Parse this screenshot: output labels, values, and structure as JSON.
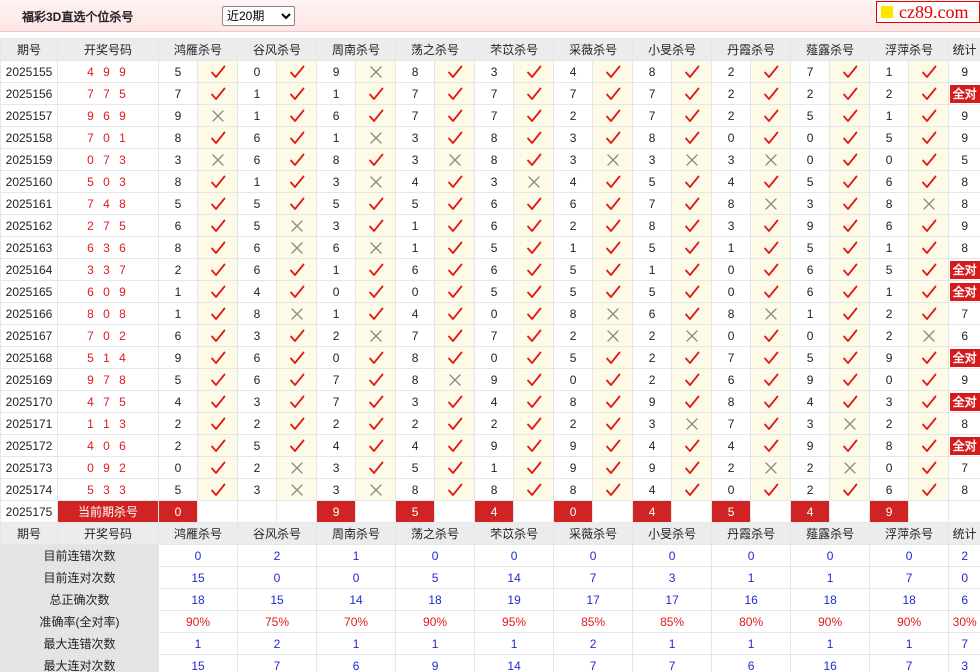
{
  "header": {
    "title": "福彩3D直选个位杀号",
    "period_select": "近20期",
    "logo": "cz89.com"
  },
  "columns": [
    "期号",
    "开奖号码",
    "鸿雁杀号",
    "谷风杀号",
    "周南杀号",
    "荡之杀号",
    "芣苡杀号",
    "采薇杀号",
    "小旻杀号",
    "丹霞杀号",
    "薤露杀号",
    "浮萍杀号",
    "统计"
  ],
  "rows": [
    {
      "period": "2025155",
      "win": "4 9 9",
      "kills": [
        [
          "5",
          "y"
        ],
        [
          "0",
          "y"
        ],
        [
          "9",
          "n"
        ],
        [
          "8",
          "y"
        ],
        [
          "3",
          "y"
        ],
        [
          "4",
          "y"
        ],
        [
          "8",
          "y"
        ],
        [
          "2",
          "y"
        ],
        [
          "7",
          "y"
        ],
        [
          "1",
          "y"
        ]
      ],
      "stat": "9"
    },
    {
      "period": "2025156",
      "win": "7 7 5",
      "kills": [
        [
          "7",
          "y"
        ],
        [
          "1",
          "y"
        ],
        [
          "1",
          "y"
        ],
        [
          "7",
          "y"
        ],
        [
          "7",
          "y"
        ],
        [
          "7",
          "y"
        ],
        [
          "7",
          "y"
        ],
        [
          "2",
          "y"
        ],
        [
          "2",
          "y"
        ],
        [
          "2",
          "y"
        ]
      ],
      "stat": "全对"
    },
    {
      "period": "2025157",
      "win": "9 6 9",
      "kills": [
        [
          "9",
          "n"
        ],
        [
          "1",
          "y"
        ],
        [
          "6",
          "y"
        ],
        [
          "7",
          "y"
        ],
        [
          "7",
          "y"
        ],
        [
          "2",
          "y"
        ],
        [
          "7",
          "y"
        ],
        [
          "2",
          "y"
        ],
        [
          "5",
          "y"
        ],
        [
          "1",
          "y"
        ]
      ],
      "stat": "9"
    },
    {
      "period": "2025158",
      "win": "7 0 1",
      "kills": [
        [
          "8",
          "y"
        ],
        [
          "6",
          "y"
        ],
        [
          "1",
          "n"
        ],
        [
          "3",
          "y"
        ],
        [
          "8",
          "y"
        ],
        [
          "3",
          "y"
        ],
        [
          "8",
          "y"
        ],
        [
          "0",
          "y"
        ],
        [
          "0",
          "y"
        ],
        [
          "5",
          "y"
        ]
      ],
      "stat": "9"
    },
    {
      "period": "2025159",
      "win": "0 7 3",
      "kills": [
        [
          "3",
          "n"
        ],
        [
          "6",
          "y"
        ],
        [
          "8",
          "y"
        ],
        [
          "3",
          "n"
        ],
        [
          "8",
          "y"
        ],
        [
          "3",
          "n"
        ],
        [
          "3",
          "n"
        ],
        [
          "3",
          "n"
        ],
        [
          "0",
          "y"
        ],
        [
          "0",
          "y"
        ]
      ],
      "stat": "5"
    },
    {
      "period": "2025160",
      "win": "5 0 3",
      "kills": [
        [
          "8",
          "y"
        ],
        [
          "1",
          "y"
        ],
        [
          "3",
          "n"
        ],
        [
          "4",
          "y"
        ],
        [
          "3",
          "n"
        ],
        [
          "4",
          "y"
        ],
        [
          "5",
          "y"
        ],
        [
          "4",
          "y"
        ],
        [
          "5",
          "y"
        ],
        [
          "6",
          "y"
        ]
      ],
      "stat": "8"
    },
    {
      "period": "2025161",
      "win": "7 4 8",
      "kills": [
        [
          "5",
          "y"
        ],
        [
          "5",
          "y"
        ],
        [
          "5",
          "y"
        ],
        [
          "5",
          "y"
        ],
        [
          "6",
          "y"
        ],
        [
          "6",
          "y"
        ],
        [
          "7",
          "y"
        ],
        [
          "8",
          "n"
        ],
        [
          "3",
          "y"
        ],
        [
          "8",
          "n"
        ]
      ],
      "stat": "8"
    },
    {
      "period": "2025162",
      "win": "2 7 5",
      "kills": [
        [
          "6",
          "y"
        ],
        [
          "5",
          "n"
        ],
        [
          "3",
          "y"
        ],
        [
          "1",
          "y"
        ],
        [
          "6",
          "y"
        ],
        [
          "2",
          "y"
        ],
        [
          "8",
          "y"
        ],
        [
          "3",
          "y"
        ],
        [
          "9",
          "y"
        ],
        [
          "6",
          "y"
        ]
      ],
      "stat": "9"
    },
    {
      "period": "2025163",
      "win": "6 3 6",
      "kills": [
        [
          "8",
          "y"
        ],
        [
          "6",
          "n"
        ],
        [
          "6",
          "n"
        ],
        [
          "1",
          "y"
        ],
        [
          "5",
          "y"
        ],
        [
          "1",
          "y"
        ],
        [
          "5",
          "y"
        ],
        [
          "1",
          "y"
        ],
        [
          "5",
          "y"
        ],
        [
          "1",
          "y"
        ]
      ],
      "stat": "8"
    },
    {
      "period": "2025164",
      "win": "3 3 7",
      "kills": [
        [
          "2",
          "y"
        ],
        [
          "6",
          "y"
        ],
        [
          "1",
          "y"
        ],
        [
          "6",
          "y"
        ],
        [
          "6",
          "y"
        ],
        [
          "5",
          "y"
        ],
        [
          "1",
          "y"
        ],
        [
          "0",
          "y"
        ],
        [
          "6",
          "y"
        ],
        [
          "5",
          "y"
        ]
      ],
      "stat": "全对"
    },
    {
      "period": "2025165",
      "win": "6 0 9",
      "kills": [
        [
          "1",
          "y"
        ],
        [
          "4",
          "y"
        ],
        [
          "0",
          "y"
        ],
        [
          "0",
          "y"
        ],
        [
          "5",
          "y"
        ],
        [
          "5",
          "y"
        ],
        [
          "5",
          "y"
        ],
        [
          "0",
          "y"
        ],
        [
          "6",
          "y"
        ],
        [
          "1",
          "y"
        ]
      ],
      "stat": "全对"
    },
    {
      "period": "2025166",
      "win": "8 0 8",
      "kills": [
        [
          "1",
          "y"
        ],
        [
          "8",
          "n"
        ],
        [
          "1",
          "y"
        ],
        [
          "4",
          "y"
        ],
        [
          "0",
          "y"
        ],
        [
          "8",
          "n"
        ],
        [
          "6",
          "y"
        ],
        [
          "8",
          "n"
        ],
        [
          "1",
          "y"
        ],
        [
          "2",
          "y"
        ]
      ],
      "stat": "7"
    },
    {
      "period": "2025167",
      "win": "7 0 2",
      "kills": [
        [
          "6",
          "y"
        ],
        [
          "3",
          "y"
        ],
        [
          "2",
          "n"
        ],
        [
          "7",
          "y"
        ],
        [
          "7",
          "y"
        ],
        [
          "2",
          "n"
        ],
        [
          "2",
          "n"
        ],
        [
          "0",
          "y"
        ],
        [
          "0",
          "y"
        ],
        [
          "2",
          "n"
        ]
      ],
      "stat": "6"
    },
    {
      "period": "2025168",
      "win": "5 1 4",
      "kills": [
        [
          "9",
          "y"
        ],
        [
          "6",
          "y"
        ],
        [
          "0",
          "y"
        ],
        [
          "8",
          "y"
        ],
        [
          "0",
          "y"
        ],
        [
          "5",
          "y"
        ],
        [
          "2",
          "y"
        ],
        [
          "7",
          "y"
        ],
        [
          "5",
          "y"
        ],
        [
          "9",
          "y"
        ]
      ],
      "stat": "全对"
    },
    {
      "period": "2025169",
      "win": "9 7 8",
      "kills": [
        [
          "5",
          "y"
        ],
        [
          "6",
          "y"
        ],
        [
          "7",
          "y"
        ],
        [
          "8",
          "n"
        ],
        [
          "9",
          "y"
        ],
        [
          "0",
          "y"
        ],
        [
          "2",
          "y"
        ],
        [
          "6",
          "y"
        ],
        [
          "9",
          "y"
        ],
        [
          "0",
          "y"
        ]
      ],
      "stat": "9"
    },
    {
      "period": "2025170",
      "win": "4 7 5",
      "kills": [
        [
          "4",
          "y"
        ],
        [
          "3",
          "y"
        ],
        [
          "7",
          "y"
        ],
        [
          "3",
          "y"
        ],
        [
          "4",
          "y"
        ],
        [
          "8",
          "y"
        ],
        [
          "9",
          "y"
        ],
        [
          "8",
          "y"
        ],
        [
          "4",
          "y"
        ],
        [
          "3",
          "y"
        ]
      ],
      "stat": "全对"
    },
    {
      "period": "2025171",
      "win": "1 1 3",
      "kills": [
        [
          "2",
          "y"
        ],
        [
          "2",
          "y"
        ],
        [
          "2",
          "y"
        ],
        [
          "2",
          "y"
        ],
        [
          "2",
          "y"
        ],
        [
          "2",
          "y"
        ],
        [
          "3",
          "n"
        ],
        [
          "7",
          "y"
        ],
        [
          "3",
          "n"
        ],
        [
          "2",
          "y"
        ]
      ],
      "stat": "8"
    },
    {
      "period": "2025172",
      "win": "4 0 6",
      "kills": [
        [
          "2",
          "y"
        ],
        [
          "5",
          "y"
        ],
        [
          "4",
          "y"
        ],
        [
          "4",
          "y"
        ],
        [
          "9",
          "y"
        ],
        [
          "9",
          "y"
        ],
        [
          "4",
          "y"
        ],
        [
          "4",
          "y"
        ],
        [
          "9",
          "y"
        ],
        [
          "8",
          "y"
        ]
      ],
      "stat": "全对"
    },
    {
      "period": "2025173",
      "win": "0 9 2",
      "kills": [
        [
          "0",
          "y"
        ],
        [
          "2",
          "n"
        ],
        [
          "3",
          "y"
        ],
        [
          "5",
          "y"
        ],
        [
          "1",
          "y"
        ],
        [
          "9",
          "y"
        ],
        [
          "9",
          "y"
        ],
        [
          "2",
          "n"
        ],
        [
          "2",
          "n"
        ],
        [
          "0",
          "y"
        ]
      ],
      "stat": "7"
    },
    {
      "period": "2025174",
      "win": "5 3 3",
      "kills": [
        [
          "5",
          "y"
        ],
        [
          "3",
          "n"
        ],
        [
          "3",
          "n"
        ],
        [
          "8",
          "y"
        ],
        [
          "8",
          "y"
        ],
        [
          "8",
          "y"
        ],
        [
          "4",
          "y"
        ],
        [
          "0",
          "y"
        ],
        [
          "2",
          "y"
        ],
        [
          "6",
          "y"
        ]
      ],
      "stat": "8"
    }
  ],
  "current": {
    "period": "2025175",
    "label": "当前期杀号",
    "kills": [
      "0",
      "",
      "9",
      "5",
      "4",
      "0",
      "4",
      "5",
      "4",
      "9"
    ]
  },
  "stats": [
    {
      "label": "目前连错次数",
      "values": [
        "0",
        "2",
        "1",
        "0",
        "0",
        "0",
        "0",
        "0",
        "0",
        "0",
        "2"
      ],
      "red": false
    },
    {
      "label": "目前连对次数",
      "values": [
        "15",
        "0",
        "0",
        "5",
        "14",
        "7",
        "3",
        "1",
        "1",
        "7",
        "0"
      ],
      "red": false
    },
    {
      "label": "总正确次数",
      "values": [
        "18",
        "15",
        "14",
        "18",
        "19",
        "17",
        "17",
        "16",
        "18",
        "18",
        "6"
      ],
      "red": false
    },
    {
      "label": "准确率(全对率)",
      "values": [
        "90%",
        "75%",
        "70%",
        "90%",
        "95%",
        "85%",
        "85%",
        "80%",
        "90%",
        "90%",
        "30%"
      ],
      "red": true
    },
    {
      "label": "最大连错次数",
      "values": [
        "1",
        "2",
        "1",
        "1",
        "1",
        "2",
        "1",
        "1",
        "1",
        "1",
        "7"
      ],
      "red": false
    },
    {
      "label": "最大连对次数",
      "values": [
        "15",
        "7",
        "6",
        "9",
        "14",
        "7",
        "7",
        "6",
        "16",
        "7",
        "3"
      ],
      "red": false
    }
  ],
  "colors": {
    "accent": "#d02323",
    "check": "#e01a1a",
    "cross": "#8a8a8a",
    "stat_blue": "#1f2bd0"
  }
}
